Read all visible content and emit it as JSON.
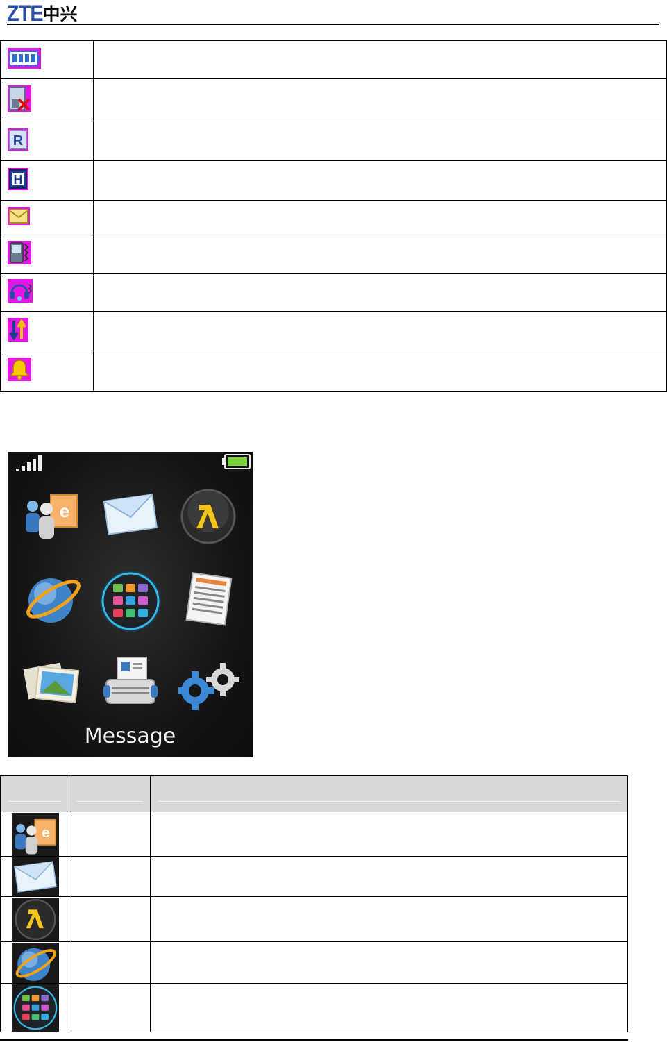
{
  "header": {
    "logo_latin": "ZTE",
    "logo_chinese": "中兴"
  },
  "status_icons": [
    {
      "icon": "battery-icon"
    },
    {
      "icon": "no-sim-icon"
    },
    {
      "icon": "roaming-icon"
    },
    {
      "icon": "hsdpa-icon"
    },
    {
      "icon": "new-message-icon"
    },
    {
      "icon": "vibrate-icon"
    },
    {
      "icon": "headset-icon"
    },
    {
      "icon": "data-transfer-icon"
    },
    {
      "icon": "alarm-icon"
    }
  ],
  "phone_screen": {
    "caption": "Message",
    "apps": [
      "contacts-browser-icon",
      "message-icon",
      "yellow-pages-icon",
      "browser-globe-icon",
      "applications-icon",
      "notes-icon",
      "gallery-icon",
      "phonebook-icon",
      "settings-icon"
    ]
  },
  "menu_table": {
    "rows": [
      {
        "icon": "contacts-browser-icon"
      },
      {
        "icon": "message-icon"
      },
      {
        "icon": "yellow-pages-icon"
      },
      {
        "icon": "browser-globe-icon"
      },
      {
        "icon": "applications-icon"
      }
    ]
  },
  "colors": {
    "logo_blue": "#2a4ea6",
    "status_icon_border": "#e316e3",
    "screen_bg": "#161616",
    "header_row": "#d8d8d8"
  }
}
